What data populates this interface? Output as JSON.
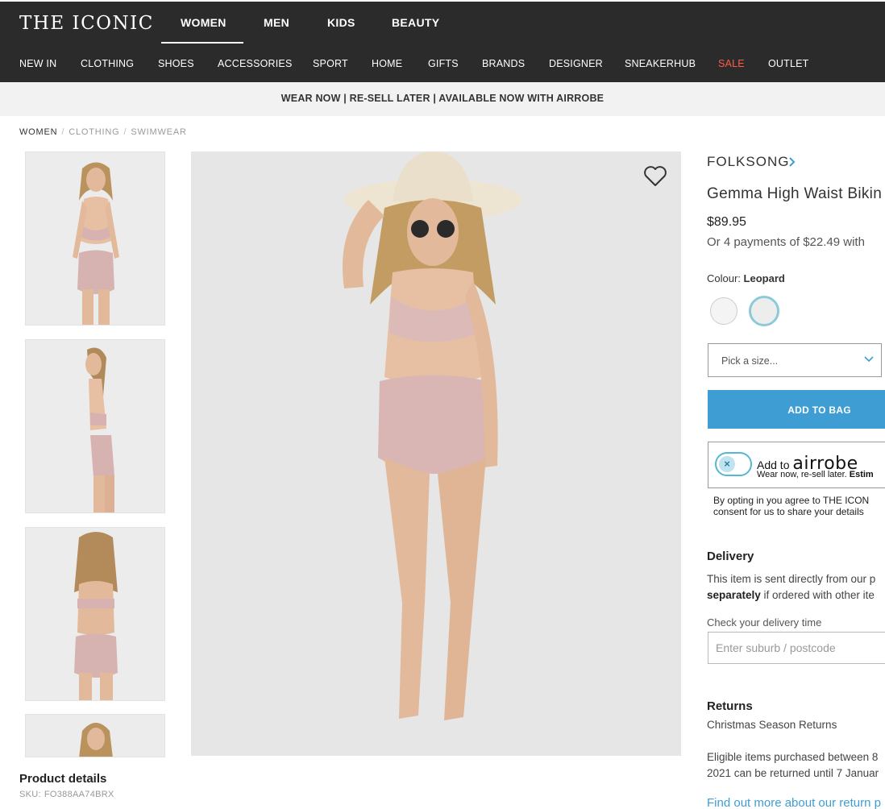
{
  "header": {
    "logo": "THE ICONIC",
    "gender_tabs": [
      "WOMEN",
      "MEN",
      "KIDS",
      "BEAUTY"
    ],
    "active_gender": "WOMEN",
    "categories": [
      "NEW IN",
      "CLOTHING",
      "SHOES",
      "ACCESSORIES",
      "SPORT",
      "HOME",
      "GIFTS",
      "BRANDS",
      "DESIGNER",
      "SNEAKERHUB",
      "SALE",
      "OUTLET"
    ],
    "sale_color": "#ff5a4b"
  },
  "promo": {
    "text": "WEAR NOW | RE-SELL LATER | AVAILABLE NOW WITH AIRROBE"
  },
  "breadcrumb": [
    "WOMEN",
    "CLOTHING",
    "SWIMWEAR"
  ],
  "gallery": {
    "thumbnails": [
      "front view",
      "side view",
      "back view",
      "front view"
    ],
    "wishlist_icon": "heart-icon"
  },
  "product": {
    "brand": "FOLKSONG",
    "name": "Gemma High Waist Bikin",
    "price": "$89.95",
    "afterpay": "Or 4 payments of $22.49 with",
    "colour_label": "Colour:",
    "colour_value": "Leopard",
    "size_placeholder": "Pick a size...",
    "add_to_bag": "ADD TO BAG"
  },
  "airrobe": {
    "add_text": "Add to",
    "wordmark": "airrobe",
    "sub_text": "Wear now, re-sell later.",
    "sub_bold": "Estim",
    "toggle_symbol": "×",
    "consent_line1": "By opting in you agree to THE ICON",
    "consent_line2": "consent for us to share your details"
  },
  "delivery": {
    "heading": "Delivery",
    "line1": "This item is sent directly from our p",
    "line2_bold": "separately",
    "line2_rest": " if ordered with other ite",
    "check_label": "Check your delivery time",
    "postcode_placeholder": "Enter suburb / postcode"
  },
  "returns": {
    "heading": "Returns",
    "season": "Christmas Season Returns",
    "line1": "Eligible items purchased between 8",
    "line2": "2021 can be returned until 7 Januar",
    "link": "Find out more about our return p"
  },
  "details": {
    "heading": "Product details",
    "sku_label": "SKU:",
    "sku": "FO388AA74BRX"
  }
}
